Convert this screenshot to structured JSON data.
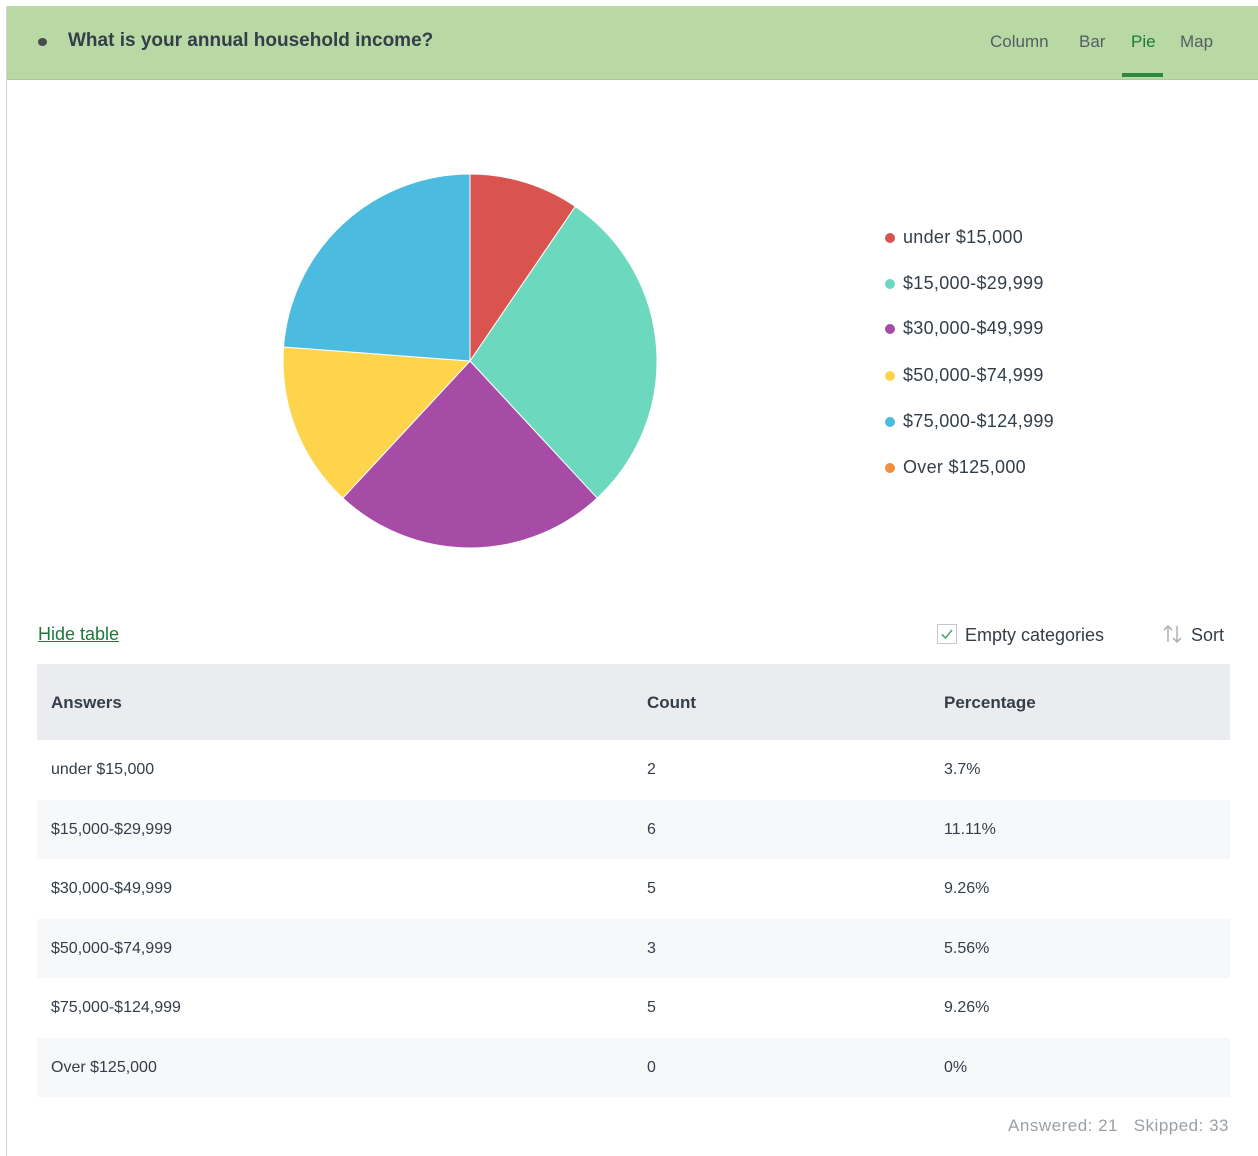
{
  "question": {
    "title": "What is your annual household income?"
  },
  "tabs": [
    {
      "label": "Column",
      "active": false
    },
    {
      "label": "Bar",
      "active": false
    },
    {
      "label": "Pie",
      "active": true
    },
    {
      "label": "Map",
      "active": false
    }
  ],
  "colors": {
    "header_bg": "#b8d9a4",
    "active_tab": "#1b7a3a",
    "link": "#1b7a3a"
  },
  "chart_data": {
    "type": "pie",
    "categories": [
      "under $15,000",
      "$15,000-$29,999",
      "$30,000-$49,999",
      "$50,000-$74,999",
      "$75,000-$124,999",
      "Over $125,000"
    ],
    "values": [
      2,
      6,
      5,
      3,
      5,
      0
    ],
    "colors": [
      "#d9534f",
      "#6cd8be",
      "#a64ca6",
      "#ffd44d",
      "#4bbbe0",
      "#f28e3c"
    ],
    "legend_position": "right"
  },
  "table_controls": {
    "hide_table_label": "Hide table",
    "empty_categories_label": "Empty categories",
    "empty_categories_checked": true,
    "sort_label": "Sort"
  },
  "table": {
    "headers": [
      "Answers",
      "Count",
      "Percentage"
    ],
    "rows": [
      {
        "answer": "under $15,000",
        "count": "2",
        "percentage": "3.7%"
      },
      {
        "answer": "$15,000-$29,999",
        "count": "6",
        "percentage": "11.11%"
      },
      {
        "answer": "$30,000-$49,999",
        "count": "5",
        "percentage": "9.26%"
      },
      {
        "answer": "$50,000-$74,999",
        "count": "3",
        "percentage": "5.56%"
      },
      {
        "answer": "$75,000-$124,999",
        "count": "5",
        "percentage": "9.26%"
      },
      {
        "answer": "Over $125,000",
        "count": "0",
        "percentage": "0%"
      }
    ]
  },
  "footer": {
    "answered_label": "Answered: 21",
    "skipped_label": "Skipped: 33"
  }
}
